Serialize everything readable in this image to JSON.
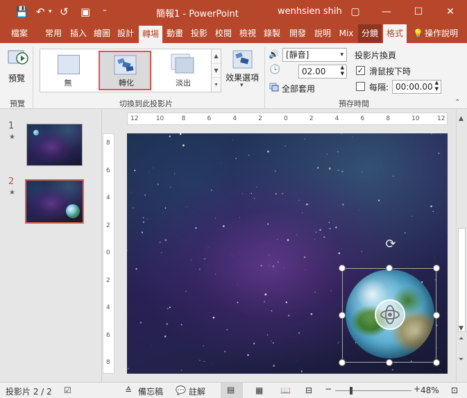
{
  "window": {
    "title": "簡報1 - PowerPoint",
    "user": "wenhsien shih",
    "restore_glyph": "▢",
    "minimize_glyph": "—",
    "maximize_glyph": "☐",
    "close_glyph": "✕"
  },
  "qat": {
    "save": "💾",
    "undo": "↶",
    "undo_arrow": "▾",
    "redo": "↺",
    "present": "▣",
    "more": "⁼"
  },
  "tabs": [
    {
      "label": "檔案"
    },
    {
      "label": "常用"
    },
    {
      "label": "插入"
    },
    {
      "label": "繪圖"
    },
    {
      "label": "設計"
    },
    {
      "label": "轉場"
    },
    {
      "label": "動畫"
    },
    {
      "label": "投影"
    },
    {
      "label": "校閱"
    },
    {
      "label": "檢視"
    },
    {
      "label": "錄製"
    },
    {
      "label": "開發"
    },
    {
      "label": "說明"
    },
    {
      "label": "Mix"
    },
    {
      "label": "分鏡"
    },
    {
      "label": "格式"
    },
    {
      "label": "操作說明"
    }
  ],
  "ribbon": {
    "preview": {
      "label": "預覽",
      "group": "預覽"
    },
    "gallery": {
      "items": [
        {
          "label": "無"
        },
        {
          "label": "轉化"
        },
        {
          "label": "淡出"
        }
      ],
      "group": "切換到此投影片"
    },
    "effect_options": {
      "label": "效果選項",
      "arrow": "▾"
    },
    "timing": {
      "sound_value": "[靜音]",
      "duration_value": "02.00",
      "apply_all": "全部套用",
      "advance_title": "投影片換頁",
      "on_click": "滑鼠按下時",
      "after": "每隔:",
      "after_value": "00:00.00",
      "group": "預存時間"
    }
  },
  "slides": [
    {
      "number": "1",
      "star": "★"
    },
    {
      "number": "2",
      "star": "★"
    }
  ],
  "ruler": {
    "h_labels": [
      "12",
      "10",
      "8",
      "6",
      "4",
      "2",
      "0",
      "2",
      "4",
      "6",
      "8",
      "10",
      "12"
    ],
    "v_labels": [
      "8",
      "6",
      "4",
      "2",
      "0",
      "2",
      "4",
      "6",
      "8"
    ]
  },
  "status": {
    "slide_info": "投影片 2 / 2",
    "notes": "備忘稿",
    "comments": "註解",
    "zoom_minus": "−",
    "zoom_plus": "+",
    "zoom": "48%"
  },
  "colors": {
    "accent": "#b7472a",
    "selection": "#e0514a"
  }
}
